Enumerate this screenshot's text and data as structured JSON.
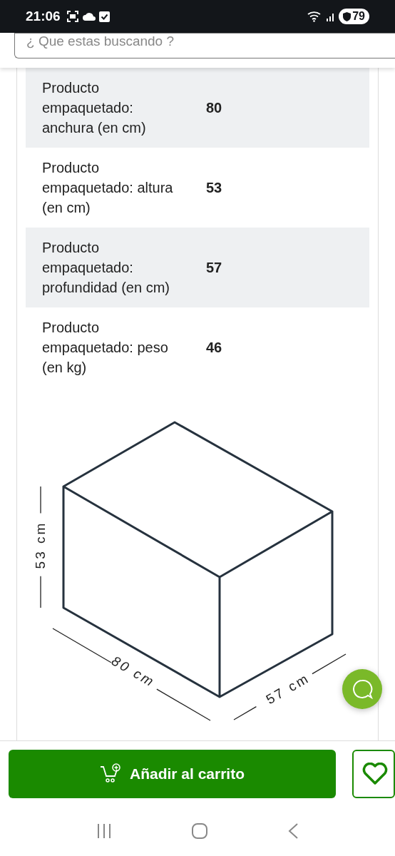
{
  "status_bar": {
    "time": "21:06",
    "battery": "79"
  },
  "search": {
    "placeholder": "¿ Que estas buscando ?"
  },
  "specs": [
    {
      "label": "Producto empaquetado: anchura (en cm)",
      "value": "80"
    },
    {
      "label": "Producto empaquetado: altura (en cm)",
      "value": "53"
    },
    {
      "label": "Producto empaquetado: profundidad (en cm)",
      "value": "57"
    },
    {
      "label": "Producto empaquetado: peso (en kg)",
      "value": "46"
    }
  ],
  "diagram": {
    "height_label": "53 cm",
    "width_label": "80 cm",
    "depth_label": "57 cm"
  },
  "add_to_cart": {
    "label": "Añadir al carrito"
  }
}
